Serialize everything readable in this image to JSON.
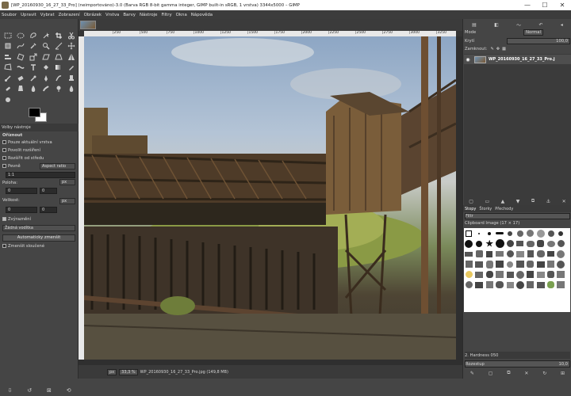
{
  "window": {
    "title": "[WP_20160930_16_27_33_Pro] (neimportováno)-3.0 (Barva RGB 8-bit gamma integer, GIMP built-in sRGB, 1 vrstva) 3344x5000 – GIMP",
    "min": "—",
    "max": "☐",
    "close": "✕"
  },
  "menu": [
    "Soubor",
    "Upravit",
    "Vybrat",
    "Zobrazení",
    "Obrázek",
    "Vrstva",
    "Barvy",
    "Nástroje",
    "Filtry",
    "Okna",
    "Nápověda"
  ],
  "toolbox": {
    "tool_options_tab": "Volby nástroje",
    "section": "Oříznout",
    "opt_current_layer": "Pouze aktuální vrstva",
    "opt_allow_grow": "Povolit rozšíření",
    "opt_from_center": "Rozšířit od středu",
    "fixed_label": "Pevně",
    "fixed_mode": "Aspect ratio",
    "ratio_value": "1:1",
    "position_label": "Poloha:",
    "position_x": "0",
    "position_y": "0",
    "position_unit": "px",
    "size_label": "Velikost:",
    "size_w": "0",
    "size_h": "0",
    "size_unit": "px",
    "highlight": "Zvýraznění",
    "guides": "Žádná vodítka",
    "auto_shrink": "Automaticky zmenšit",
    "shrink_merged": "Zmenšit sloučené"
  },
  "canvas": {
    "ruler_marks": [
      "|250",
      "|500",
      "|750",
      "|1000",
      "|1250",
      "|1500",
      "|1750",
      "|2000",
      "|2250",
      "|2500",
      "|2750",
      "|3000",
      "|3250"
    ],
    "unit": "px",
    "zoom": "33,3 %",
    "status_text": "WP_20160930_16_27_33_Pro.jpg (149,8 MB)"
  },
  "dock": {
    "mode_label": "Mode",
    "mode_value": "Normal",
    "opacity_label": "Krytí",
    "opacity_value": "100,0",
    "lock_label": "Zamknout:",
    "layer_name": "WP_20160930_16_27_33_Pro.j",
    "tabs": [
      "Stopy",
      "Štorky",
      "Přechody"
    ],
    "filter_placeholder": "Filtr",
    "brush_name": "Clipboard Image (17 × 17)",
    "brush_footer": "2. Hardness 050",
    "spacing_label": "Rozestup",
    "spacing_value": "10,0"
  }
}
